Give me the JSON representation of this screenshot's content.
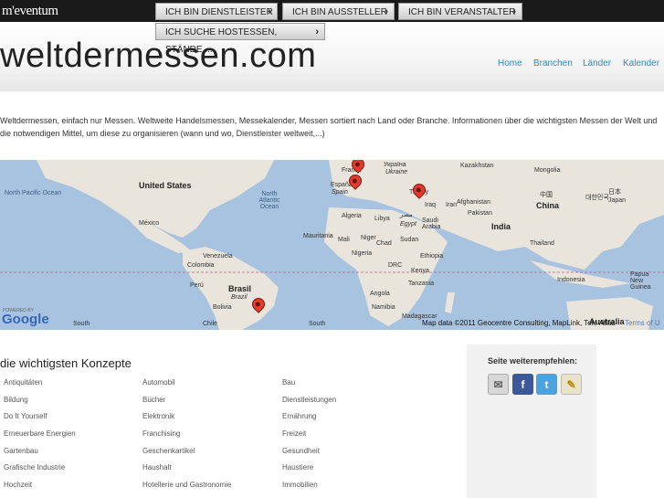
{
  "brand": {
    "logo_text": "m'eventum",
    "site_title": "weltdermessen.com"
  },
  "buttons": [
    {
      "label": "ICH BIN DIENSTLEISTER"
    },
    {
      "label": "ICH BIN AUSSTELLER"
    },
    {
      "label": "ICH BIN VERANSTALTER"
    },
    {
      "label": "ICH SUCHE HOSTESSEN, STÄNDE,..."
    }
  ],
  "nav": [
    "Home",
    "Branchen",
    "Länder",
    "Kalender"
  ],
  "intro": "Weltdermessen, einfach nur Messen. Weltweite Handelsmessen, Messekalender, Messen sortiert nach Land oder Branche. Informationen über die wichtigsten Messen der Welt und die notwendigen Mittel, um diese zu organisieren (wann und wo, Dienstleister weltweit,...)",
  "map": {
    "labels": {
      "united_states": "United States",
      "north_pacific": "North Pacific Ocean",
      "north_atlantic": "North Atlantic Ocean",
      "mexico": "México",
      "venezuela": "Venezuela",
      "colombia": "Colombia",
      "peru": "Perú",
      "brasil": "Brasil",
      "brazil_it": "Brazil",
      "bolivia": "Bolivia",
      "chile": "Chile",
      "south1": "South",
      "south2": "South",
      "france": "France",
      "spain": "España",
      "spain_it": "Spain",
      "algeria": "Algeria",
      "libya": "Libya",
      "egypt_ar": "مصر",
      "egypt": "Egypt",
      "mali": "Mali",
      "niger": "Niger",
      "chad": "Chad",
      "sudan": "Sudan",
      "mauritania": "Mauritania",
      "nigeria": "Nigeria",
      "ethiopia": "Ethiopia",
      "drc": "DRC",
      "kenya": "Kenya",
      "tanzania": "Tanzania",
      "angola": "Angola",
      "namibia": "Namibia",
      "south_africa": "South Africa",
      "madagascar": "Madagascar",
      "ukraine_cyr": "Україна",
      "ukraine": "Ukraine",
      "kazakhstan": "Kazakhstan",
      "mongolia": "Mongolia",
      "turkey": "Turkey",
      "iraq": "Iraq",
      "iran": "Iran",
      "afghanistan": "Afghanistan",
      "pakistan": "Pakistan",
      "saudi_arabia": "Saudi Arabia",
      "india": "India",
      "china_cn": "中国",
      "china": "China",
      "korea": "대한민국",
      "japan_jp": "日本",
      "japan": "Japan",
      "thailand": "Thailand",
      "indonesia": "Indonesia",
      "png": "Papua New Guinea",
      "australia": "Australia"
    },
    "powered_by": "POWERED BY",
    "google": "Google",
    "attribution": "Map data ©2011 Geocentre Consulting, MapLink, Tele Atlas",
    "terms": "Terms of U"
  },
  "konzepte": {
    "title": "die wichtigsten Konzepte",
    "columns": [
      [
        "Antiquitäten",
        "Bildung",
        "Do It Yourself",
        "Erneuerbare Energien",
        "Gartenbau",
        "Grafische Industrie",
        "Hochzeit"
      ],
      [
        "Automobil",
        "Bücher",
        "Elektronik",
        "Franchising",
        "Geschenkartikel",
        "Haushalt",
        "Hotellerie und Gastronomie"
      ],
      [
        "Bau",
        "Dienstleistungen",
        "Ernährung",
        "Freizeit",
        "Gesundheit",
        "Haustiere",
        "Immobilien"
      ]
    ]
  },
  "share": {
    "title": "Seite weiterempfehlen:",
    "icons": [
      {
        "name": "email-icon",
        "glyph": "✉",
        "color": "#d7d7d7"
      },
      {
        "name": "facebook-icon",
        "glyph": "f",
        "color": "#3b5998"
      },
      {
        "name": "twitter-icon",
        "glyph": "t",
        "color": "#4aa3df"
      },
      {
        "name": "edit-icon",
        "glyph": "✎",
        "color": "#e9e4c8"
      }
    ]
  }
}
